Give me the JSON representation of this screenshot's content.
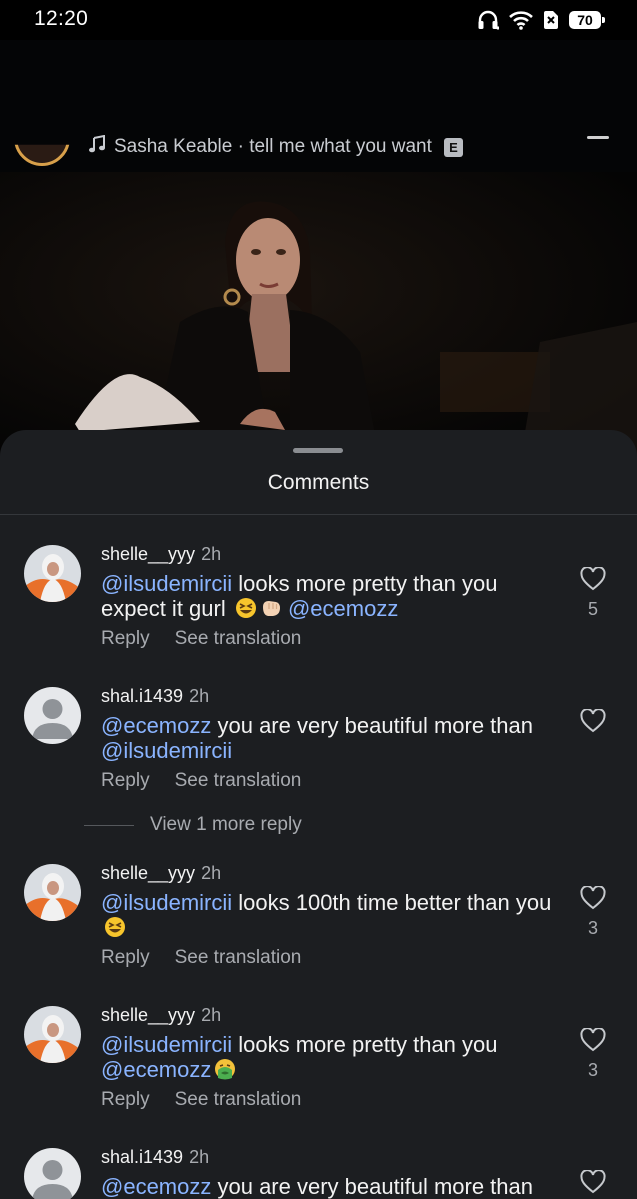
{
  "status_bar": {
    "time": "12:20",
    "battery": "70",
    "icons": [
      "headphones-icon",
      "wifi-icon",
      "no-sim-icon",
      "battery-icon"
    ]
  },
  "reel": {
    "audio_label": "Sasha Keable · tell me what you want",
    "explicit_badge": "E"
  },
  "comments_sheet": {
    "title": "Comments",
    "reply_label": "Reply",
    "translate_label": "See translation",
    "view_more": "View 1 more reply",
    "comments": [
      {
        "username": "shelle__yyy",
        "time": "2h",
        "mention1": "@ilsudemircii",
        "text1": " looks more pretty than you expect it gurl ",
        "mention2": "@ecemozz",
        "likes": "5"
      },
      {
        "username": "shal.i1439",
        "time": "2h",
        "mention1": "@ecemozz",
        "text1": " you are very beautiful more than ",
        "mention2": "@ilsudemircii"
      },
      {
        "username": "shelle__yyy",
        "time": "2h",
        "mention1": "@ilsudemircii",
        "text1": " looks 100th time better than you ",
        "likes": "3"
      },
      {
        "username": "shelle__yyy",
        "time": "2h",
        "mention1": "@ilsudemircii",
        "text1": " looks more pretty than you ",
        "mention2": "@ecemozz",
        "likes": "3"
      },
      {
        "username": "shal.i1439",
        "time": "2h",
        "mention1": "@ecemozz",
        "text1": " you are very beautiful more than"
      }
    ]
  },
  "colors": {
    "sheet_bg": "#1c1e21",
    "mention": "#8ab4ff",
    "secondary_text": "#a8abb0"
  }
}
